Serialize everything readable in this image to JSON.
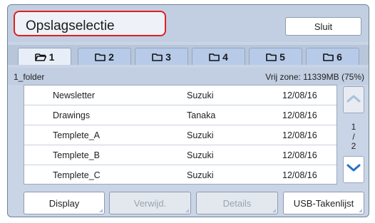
{
  "header": {
    "title": "Opslagselectie",
    "close_label": "Sluit"
  },
  "tabs": [
    {
      "label": "1",
      "icon": "folder-open-icon",
      "active": true
    },
    {
      "label": "2",
      "icon": "folder-icon",
      "active": false
    },
    {
      "label": "3",
      "icon": "folder-icon",
      "active": false
    },
    {
      "label": "4",
      "icon": "folder-icon",
      "active": false
    },
    {
      "label": "5",
      "icon": "folder-icon",
      "active": false
    },
    {
      "label": "6",
      "icon": "folder-icon",
      "active": false
    }
  ],
  "path": {
    "folder": "1_folder",
    "free_space": "Vrij zone: 11339MB (75%)"
  },
  "files": [
    {
      "name": "Newsletter",
      "owner": "Suzuki",
      "date": "12/08/16"
    },
    {
      "name": "Drawings",
      "owner": "Tanaka",
      "date": "12/08/16"
    },
    {
      "name": "Templete_A",
      "owner": "Suzuki",
      "date": "12/08/16"
    },
    {
      "name": "Templete_B",
      "owner": "Suzuki",
      "date": "12/08/16"
    },
    {
      "name": "Templete_C",
      "owner": "Suzuki",
      "date": "12/08/16"
    }
  ],
  "pager": {
    "current": "1",
    "sep": "/",
    "total": "2"
  },
  "footer": {
    "display": "Display",
    "delete": "Verwijd.",
    "details": "Details",
    "usb": "USB-Takenlijst"
  },
  "colors": {
    "accent_red": "#e02020",
    "panel_bg": "#c9d5e6",
    "arrow_blue": "#2a6fc9"
  }
}
